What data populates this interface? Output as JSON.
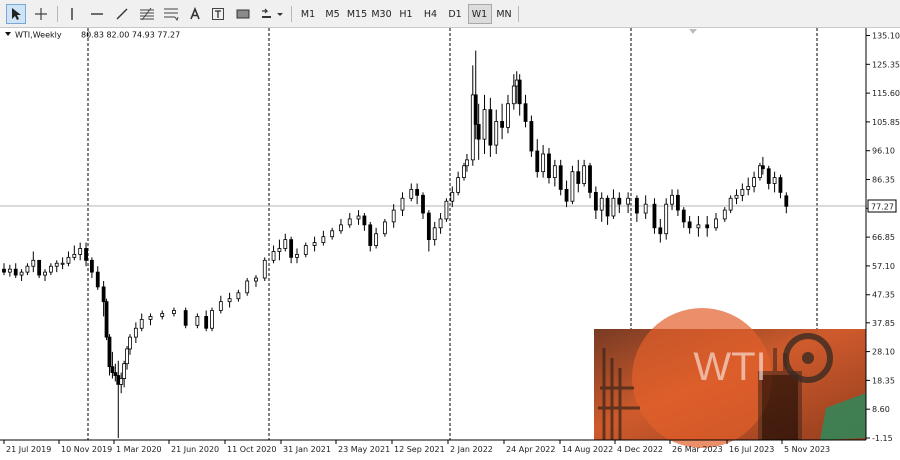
{
  "toolbar": {
    "timeframes": [
      "M1",
      "M5",
      "M15",
      "M30",
      "H1",
      "H4",
      "D1",
      "W1",
      "MN"
    ],
    "active_timeframe": "W1"
  },
  "chart_header": {
    "symbol_period": "WTI,Weekly",
    "ohlc": "80.83 82.00 74.93 77.27"
  },
  "price_label": "77.27",
  "watermark_text": "WTI",
  "colors": {
    "bull": "#ffffff",
    "bear": "#000000",
    "grid": "#000000",
    "background": "#ffffff"
  },
  "chart_data": {
    "type": "candlestick",
    "title": "",
    "xlabel": "",
    "ylabel": "",
    "ylim": [
      -1.15,
      137.0
    ],
    "last_price": 77.27,
    "y_ticks": [
      "135.10",
      "125.35",
      "115.60",
      "105.85",
      "96.10",
      "86.35",
      "76.60",
      "66.85",
      "57.10",
      "47.35",
      "37.85",
      "28.10",
      "18.35",
      "8.60",
      "-1.15"
    ],
    "y_tick_values": [
      135.1,
      125.35,
      115.6,
      105.85,
      96.1,
      86.35,
      76.6,
      66.85,
      57.1,
      47.35,
      37.85,
      28.1,
      18.35,
      8.6,
      -1.15
    ],
    "x_ticks": [
      "21 Jul 2019",
      "10 Nov 2019",
      "1 Mar 2020",
      "21 Jun 2020",
      "11 Oct 2020",
      "31 Jan 2021",
      "23 May 2021",
      "12 Sep 2021",
      "2 Jan 2022",
      "24 Apr 2022",
      "14 Aug 2022",
      "4 Dec 2022",
      "26 Mar 2023",
      "16 Jul 2023",
      "5 Nov 2023"
    ],
    "period_separators": [
      "2020",
      "2021",
      "2022",
      "2023",
      "2024"
    ],
    "grid": false,
    "ohlc": [
      {
        "w": 0,
        "o": 56,
        "h": 58,
        "l": 54,
        "c": 55
      },
      {
        "w": 2,
        "o": 55,
        "h": 57.5,
        "l": 53.5,
        "c": 56
      },
      {
        "w": 4,
        "o": 56,
        "h": 58,
        "l": 53,
        "c": 54
      },
      {
        "w": 6,
        "o": 54,
        "h": 56,
        "l": 52,
        "c": 55
      },
      {
        "w": 8,
        "o": 55,
        "h": 58,
        "l": 54,
        "c": 57
      },
      {
        "w": 10,
        "o": 57,
        "h": 62,
        "l": 55,
        "c": 59
      },
      {
        "w": 12,
        "o": 59,
        "h": 59,
        "l": 53,
        "c": 54
      },
      {
        "w": 14,
        "o": 54,
        "h": 56,
        "l": 52,
        "c": 55
      },
      {
        "w": 16,
        "o": 55,
        "h": 58,
        "l": 54,
        "c": 57
      },
      {
        "w": 18,
        "o": 57,
        "h": 59,
        "l": 55,
        "c": 58
      },
      {
        "w": 20,
        "o": 58,
        "h": 60,
        "l": 56,
        "c": 58
      },
      {
        "w": 22,
        "o": 58,
        "h": 62,
        "l": 57,
        "c": 60
      },
      {
        "w": 24,
        "o": 60,
        "h": 64,
        "l": 59,
        "c": 61
      },
      {
        "w": 26,
        "o": 61,
        "h": 65,
        "l": 59,
        "c": 63
      },
      {
        "w": 28,
        "o": 63,
        "h": 65,
        "l": 57,
        "c": 59
      },
      {
        "w": 30,
        "o": 59,
        "h": 60,
        "l": 53,
        "c": 55
      },
      {
        "w": 32,
        "o": 55,
        "h": 57,
        "l": 49,
        "c": 50
      },
      {
        "w": 34,
        "o": 50,
        "h": 52,
        "l": 40,
        "c": 45
      },
      {
        "w": 35,
        "o": 45,
        "h": 46,
        "l": 32,
        "c": 33
      },
      {
        "w": 36,
        "o": 33,
        "h": 34,
        "l": 20,
        "c": 23
      },
      {
        "w": 37,
        "o": 23,
        "h": 28,
        "l": 19,
        "c": 21
      },
      {
        "w": 38,
        "o": 21,
        "h": 24,
        "l": 18,
        "c": 20
      },
      {
        "w": 39,
        "o": 20,
        "h": 25,
        "l": -1.15,
        "c": 17
      },
      {
        "w": 40,
        "o": 17,
        "h": 21,
        "l": 14,
        "c": 19
      },
      {
        "w": 41,
        "o": 19,
        "h": 25,
        "l": 16,
        "c": 24
      },
      {
        "w": 42,
        "o": 24,
        "h": 30,
        "l": 22,
        "c": 29
      },
      {
        "w": 43,
        "o": 29,
        "h": 34,
        "l": 27,
        "c": 33
      },
      {
        "w": 45,
        "o": 33,
        "h": 38,
        "l": 31,
        "c": 36
      },
      {
        "w": 47,
        "o": 36,
        "h": 41,
        "l": 35,
        "c": 39
      },
      {
        "w": 50,
        "o": 39,
        "h": 41,
        "l": 37,
        "c": 40
      },
      {
        "w": 54,
        "o": 40,
        "h": 42,
        "l": 39,
        "c": 41
      },
      {
        "w": 58,
        "o": 41,
        "h": 43,
        "l": 40,
        "c": 42
      },
      {
        "w": 62,
        "o": 42,
        "h": 43,
        "l": 36,
        "c": 37
      },
      {
        "w": 66,
        "o": 37,
        "h": 41,
        "l": 36,
        "c": 40
      },
      {
        "w": 69,
        "o": 40,
        "h": 42,
        "l": 35,
        "c": 36
      },
      {
        "w": 71,
        "o": 36,
        "h": 43,
        "l": 35,
        "c": 42
      },
      {
        "w": 74,
        "o": 42,
        "h": 47,
        "l": 41,
        "c": 45
      },
      {
        "w": 77,
        "o": 45,
        "h": 48,
        "l": 43,
        "c": 46
      },
      {
        "w": 80,
        "o": 46,
        "h": 49,
        "l": 45,
        "c": 48
      },
      {
        "w": 83,
        "o": 48,
        "h": 53,
        "l": 47,
        "c": 52
      },
      {
        "w": 86,
        "o": 52,
        "h": 54,
        "l": 50,
        "c": 53
      },
      {
        "w": 89,
        "o": 53,
        "h": 60,
        "l": 52,
        "c": 59
      },
      {
        "w": 92,
        "o": 59,
        "h": 64,
        "l": 58,
        "c": 62
      },
      {
        "w": 94,
        "o": 62,
        "h": 66,
        "l": 59,
        "c": 63
      },
      {
        "w": 96,
        "o": 63,
        "h": 68,
        "l": 62,
        "c": 66
      },
      {
        "w": 98,
        "o": 66,
        "h": 67,
        "l": 58,
        "c": 60
      },
      {
        "w": 100,
        "o": 60,
        "h": 63,
        "l": 58,
        "c": 61
      },
      {
        "w": 103,
        "o": 61,
        "h": 65,
        "l": 60,
        "c": 64
      },
      {
        "w": 106,
        "o": 64,
        "h": 67,
        "l": 62,
        "c": 65
      },
      {
        "w": 109,
        "o": 65,
        "h": 69,
        "l": 64,
        "c": 67
      },
      {
        "w": 112,
        "o": 67,
        "h": 70,
        "l": 66,
        "c": 69
      },
      {
        "w": 115,
        "o": 69,
        "h": 73,
        "l": 68,
        "c": 71
      },
      {
        "w": 118,
        "o": 71,
        "h": 75,
        "l": 70,
        "c": 73
      },
      {
        "w": 121,
        "o": 73,
        "h": 76,
        "l": 71,
        "c": 74
      },
      {
        "w": 123,
        "o": 74,
        "h": 75,
        "l": 69,
        "c": 71
      },
      {
        "w": 125,
        "o": 71,
        "h": 72,
        "l": 62,
        "c": 64
      },
      {
        "w": 127,
        "o": 64,
        "h": 70,
        "l": 63,
        "c": 68
      },
      {
        "w": 130,
        "o": 68,
        "h": 73,
        "l": 67,
        "c": 72
      },
      {
        "w": 133,
        "o": 72,
        "h": 78,
        "l": 70,
        "c": 76
      },
      {
        "w": 136,
        "o": 76,
        "h": 82,
        "l": 74,
        "c": 80
      },
      {
        "w": 139,
        "o": 80,
        "h": 85,
        "l": 79,
        "c": 83
      },
      {
        "w": 141,
        "o": 83,
        "h": 85,
        "l": 78,
        "c": 81
      },
      {
        "w": 143,
        "o": 81,
        "h": 82,
        "l": 73,
        "c": 75
      },
      {
        "w": 145,
        "o": 75,
        "h": 76,
        "l": 62,
        "c": 66
      },
      {
        "w": 147,
        "o": 66,
        "h": 72,
        "l": 64,
        "c": 70
      },
      {
        "w": 149,
        "o": 70,
        "h": 75,
        "l": 68,
        "c": 73
      },
      {
        "w": 151,
        "o": 73,
        "h": 80,
        "l": 72,
        "c": 79
      },
      {
        "w": 153,
        "o": 79,
        "h": 84,
        "l": 77,
        "c": 82
      },
      {
        "w": 155,
        "o": 82,
        "h": 89,
        "l": 81,
        "c": 87
      },
      {
        "w": 157,
        "o": 87,
        "h": 92,
        "l": 86,
        "c": 91
      },
      {
        "w": 158,
        "o": 91,
        "h": 95,
        "l": 89,
        "c": 93
      },
      {
        "w": 160,
        "o": 93,
        "h": 125,
        "l": 91,
        "c": 115
      },
      {
        "w": 161,
        "o": 115,
        "h": 130,
        "l": 100,
        "c": 105
      },
      {
        "w": 162,
        "o": 105,
        "h": 112,
        "l": 93,
        "c": 100
      },
      {
        "w": 164,
        "o": 100,
        "h": 115,
        "l": 95,
        "c": 110
      },
      {
        "w": 166,
        "o": 110,
        "h": 114,
        "l": 94,
        "c": 98
      },
      {
        "w": 168,
        "o": 98,
        "h": 110,
        "l": 95,
        "c": 106
      },
      {
        "w": 170,
        "o": 106,
        "h": 112,
        "l": 100,
        "c": 104
      },
      {
        "w": 172,
        "o": 104,
        "h": 115,
        "l": 102,
        "c": 112
      },
      {
        "w": 174,
        "o": 112,
        "h": 122,
        "l": 110,
        "c": 118
      },
      {
        "w": 175,
        "o": 118,
        "h": 123,
        "l": 112,
        "c": 120
      },
      {
        "w": 176,
        "o": 120,
        "h": 122,
        "l": 108,
        "c": 112
      },
      {
        "w": 178,
        "o": 112,
        "h": 115,
        "l": 104,
        "c": 106
      },
      {
        "w": 180,
        "o": 106,
        "h": 108,
        "l": 94,
        "c": 96
      },
      {
        "w": 182,
        "o": 96,
        "h": 100,
        "l": 87,
        "c": 89
      },
      {
        "w": 184,
        "o": 89,
        "h": 98,
        "l": 87,
        "c": 95
      },
      {
        "w": 186,
        "o": 95,
        "h": 97,
        "l": 85,
        "c": 87
      },
      {
        "w": 188,
        "o": 87,
        "h": 93,
        "l": 84,
        "c": 91
      },
      {
        "w": 190,
        "o": 91,
        "h": 93,
        "l": 81,
        "c": 83
      },
      {
        "w": 192,
        "o": 83,
        "h": 86,
        "l": 77,
        "c": 79
      },
      {
        "w": 194,
        "o": 79,
        "h": 91,
        "l": 78,
        "c": 89
      },
      {
        "w": 196,
        "o": 89,
        "h": 93,
        "l": 82,
        "c": 85
      },
      {
        "w": 198,
        "o": 85,
        "h": 93,
        "l": 84,
        "c": 91
      },
      {
        "w": 200,
        "o": 91,
        "h": 92,
        "l": 80,
        "c": 82
      },
      {
        "w": 202,
        "o": 82,
        "h": 84,
        "l": 73,
        "c": 76
      },
      {
        "w": 204,
        "o": 76,
        "h": 82,
        "l": 72,
        "c": 80
      },
      {
        "w": 206,
        "o": 80,
        "h": 81,
        "l": 71,
        "c": 74
      },
      {
        "w": 208,
        "o": 74,
        "h": 83,
        "l": 73,
        "c": 80
      },
      {
        "w": 210,
        "o": 80,
        "h": 82,
        "l": 75,
        "c": 78
      },
      {
        "w": 213,
        "o": 78,
        "h": 82,
        "l": 75,
        "c": 80
      },
      {
        "w": 216,
        "o": 80,
        "h": 81,
        "l": 72,
        "c": 75
      },
      {
        "w": 219,
        "o": 75,
        "h": 81,
        "l": 73,
        "c": 78
      },
      {
        "w": 222,
        "o": 78,
        "h": 80,
        "l": 68,
        "c": 70
      },
      {
        "w": 224,
        "o": 70,
        "h": 73,
        "l": 65,
        "c": 68
      },
      {
        "w": 226,
        "o": 68,
        "h": 80,
        "l": 66,
        "c": 78
      },
      {
        "w": 228,
        "o": 78,
        "h": 83,
        "l": 76,
        "c": 81
      },
      {
        "w": 230,
        "o": 81,
        "h": 83,
        "l": 74,
        "c": 76
      },
      {
        "w": 232,
        "o": 76,
        "h": 77,
        "l": 70,
        "c": 72
      },
      {
        "w": 234,
        "o": 72,
        "h": 74,
        "l": 68,
        "c": 70
      },
      {
        "w": 237,
        "o": 70,
        "h": 74,
        "l": 67,
        "c": 71
      },
      {
        "w": 240,
        "o": 71,
        "h": 74,
        "l": 67,
        "c": 70
      },
      {
        "w": 243,
        "o": 70,
        "h": 75,
        "l": 69,
        "c": 73
      },
      {
        "w": 246,
        "o": 73,
        "h": 77,
        "l": 72,
        "c": 76
      },
      {
        "w": 248,
        "o": 76,
        "h": 81,
        "l": 75,
        "c": 80
      },
      {
        "w": 250,
        "o": 80,
        "h": 83,
        "l": 78,
        "c": 81
      },
      {
        "w": 252,
        "o": 81,
        "h": 85,
        "l": 79,
        "c": 83
      },
      {
        "w": 254,
        "o": 83,
        "h": 87,
        "l": 81,
        "c": 84
      },
      {
        "w": 256,
        "o": 84,
        "h": 89,
        "l": 82,
        "c": 87
      },
      {
        "w": 258,
        "o": 87,
        "h": 92,
        "l": 86,
        "c": 91
      },
      {
        "w": 259,
        "o": 91,
        "h": 94,
        "l": 88,
        "c": 90
      },
      {
        "w": 261,
        "o": 90,
        "h": 91,
        "l": 83,
        "c": 85
      },
      {
        "w": 263,
        "o": 85,
        "h": 89,
        "l": 82,
        "c": 87
      },
      {
        "w": 265,
        "o": 87,
        "h": 88,
        "l": 80,
        "c": 82
      },
      {
        "w": 267,
        "o": 80.83,
        "h": 82,
        "l": 74.93,
        "c": 77.27
      }
    ]
  }
}
